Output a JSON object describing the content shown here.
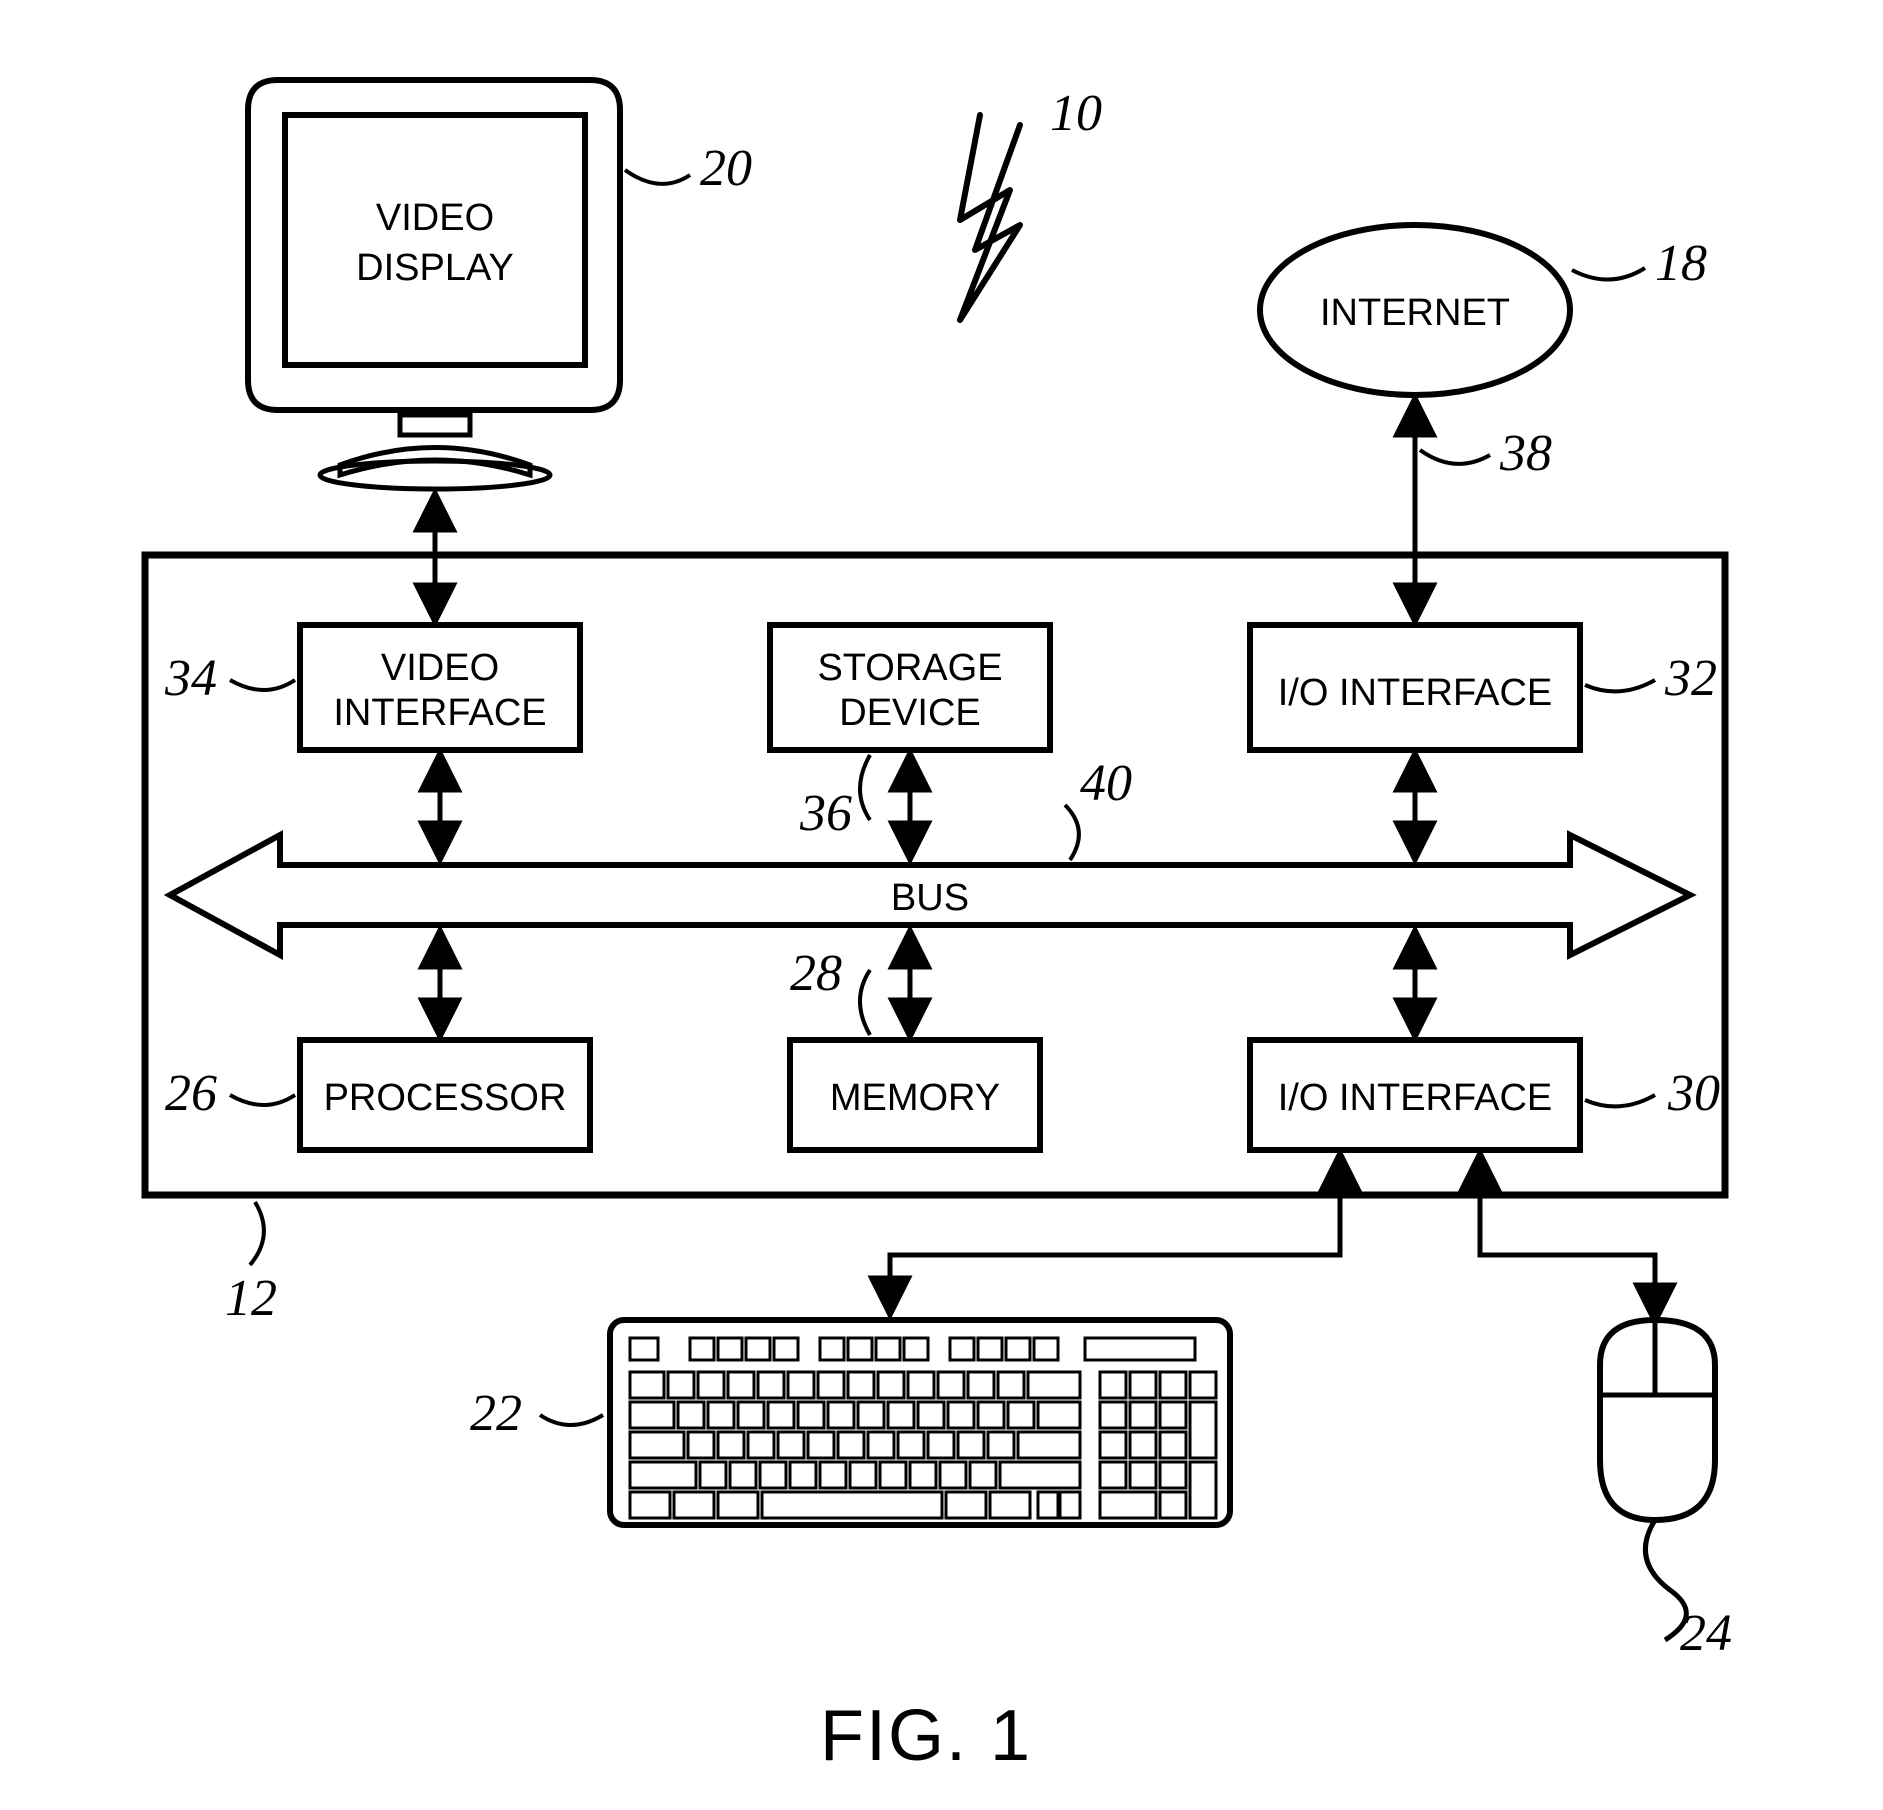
{
  "figure_label": "FIG. 1",
  "refs": {
    "system": "10",
    "computer": "12",
    "internet": "18",
    "display": "20",
    "keyboard": "22",
    "mouse": "24",
    "processor": "26",
    "memory": "28",
    "io_lower": "30",
    "io_upper": "32",
    "video_if": "34",
    "storage": "36",
    "internet_link": "38",
    "bus": "40"
  },
  "labels": {
    "video_display": [
      "VIDEO",
      "DISPLAY"
    ],
    "internet": "INTERNET",
    "video_interface": [
      "VIDEO",
      "INTERFACE"
    ],
    "storage_device": [
      "STORAGE",
      "DEVICE"
    ],
    "io_interface": "I/O INTERFACE",
    "bus": "BUS",
    "processor": "PROCESSOR",
    "memory": "MEMORY"
  }
}
